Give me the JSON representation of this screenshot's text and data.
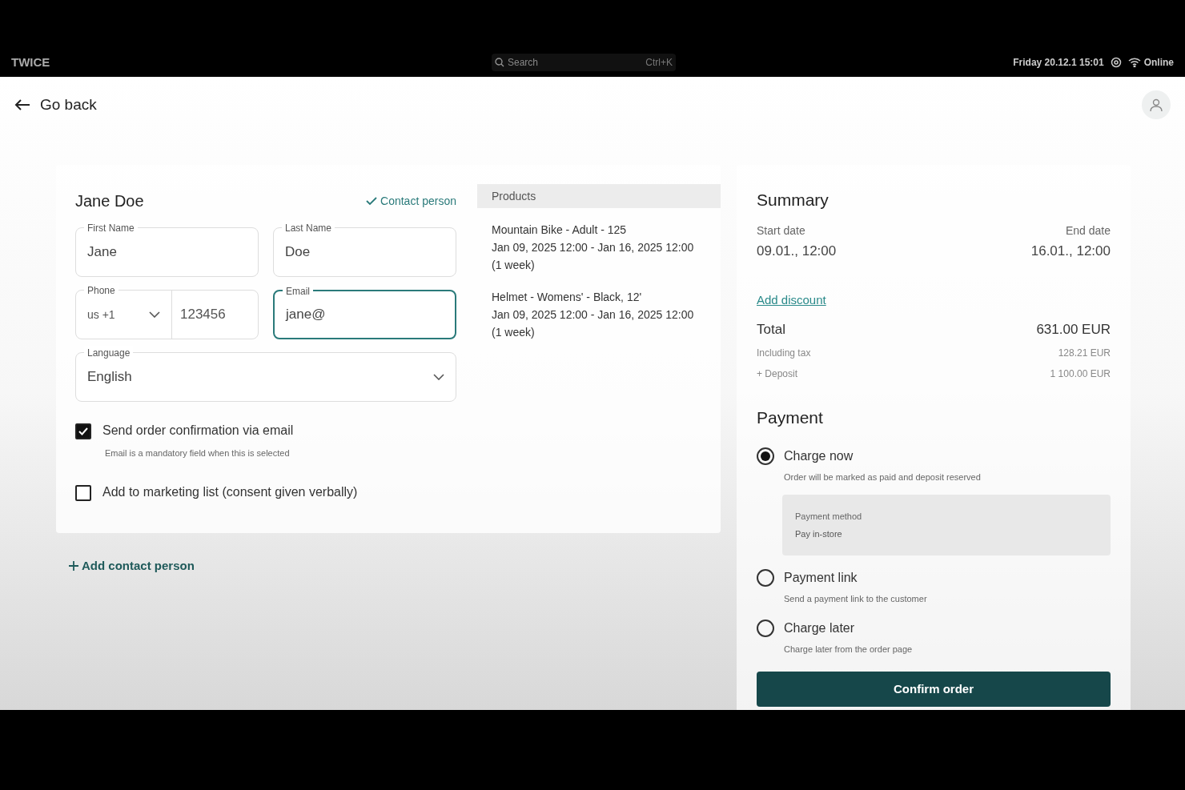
{
  "system_bar": {
    "logo": "TWICE",
    "search": {
      "placeholder": "Search",
      "shortcut": "Ctrl+K"
    },
    "datetime": "Friday 20.12.1 15:01",
    "network": "Online"
  },
  "header": {
    "back": "Go back"
  },
  "contact": {
    "name": "Jane Doe",
    "contact_person": {
      "label": "Contact person",
      "checked": true
    },
    "fields": [
      {
        "label": "First Name",
        "value": "Jane",
        "focused": false
      },
      {
        "label": "Last Name",
        "value": "Doe",
        "focused": false
      }
    ],
    "phone": {
      "label": "Phone",
      "country": "us +1",
      "value": "123456"
    },
    "email": {
      "label": "Email",
      "value": "jane@",
      "focused": true
    },
    "language": {
      "label": "Language",
      "value": "English"
    },
    "options": [
      {
        "label": "Send order confirmation via email",
        "hint": "Email is a mandatory field when this is selected",
        "checked": true
      },
      {
        "label": "Add to marketing list (consent given verbally)",
        "checked": false
      }
    ]
  },
  "add_contact": "Add contact person",
  "products": {
    "title": "Products",
    "items": [
      {
        "name": "Mountain Bike - Adult - 125",
        "period": "Jan 09, 2025 12:00 - Jan 16, 2025 12:00 (1 week)"
      },
      {
        "name": "Helmet - Womens' - Black, 12'",
        "period": "Jan 09, 2025 12:00 - Jan 16, 2025 12:00 (1 week)"
      }
    ]
  },
  "summary": {
    "title": "Summary",
    "start_label": "Start date",
    "start": "09.01., 12:00",
    "end_label": "End date",
    "end": "16.01., 12:00",
    "discount": "Add discount",
    "total_label": "Total",
    "total": "631.00 EUR",
    "tax_label": "Including tax",
    "tax": "128.21 EUR",
    "deposit_label": "+ Deposit",
    "deposit": "1 100.00 EUR"
  },
  "payment": {
    "title": "Payment",
    "options": [
      {
        "label": "Charge now",
        "hint": "Order will be marked as paid and deposit reserved",
        "selected": true,
        "method_label": "Payment method",
        "method": "Pay in-store"
      },
      {
        "label": "Payment link",
        "hint": "Send a payment link to the customer",
        "selected": false
      },
      {
        "label": "Charge later",
        "hint": "Charge later from the order page",
        "selected": false
      }
    ],
    "confirm": "Confirm order"
  }
}
